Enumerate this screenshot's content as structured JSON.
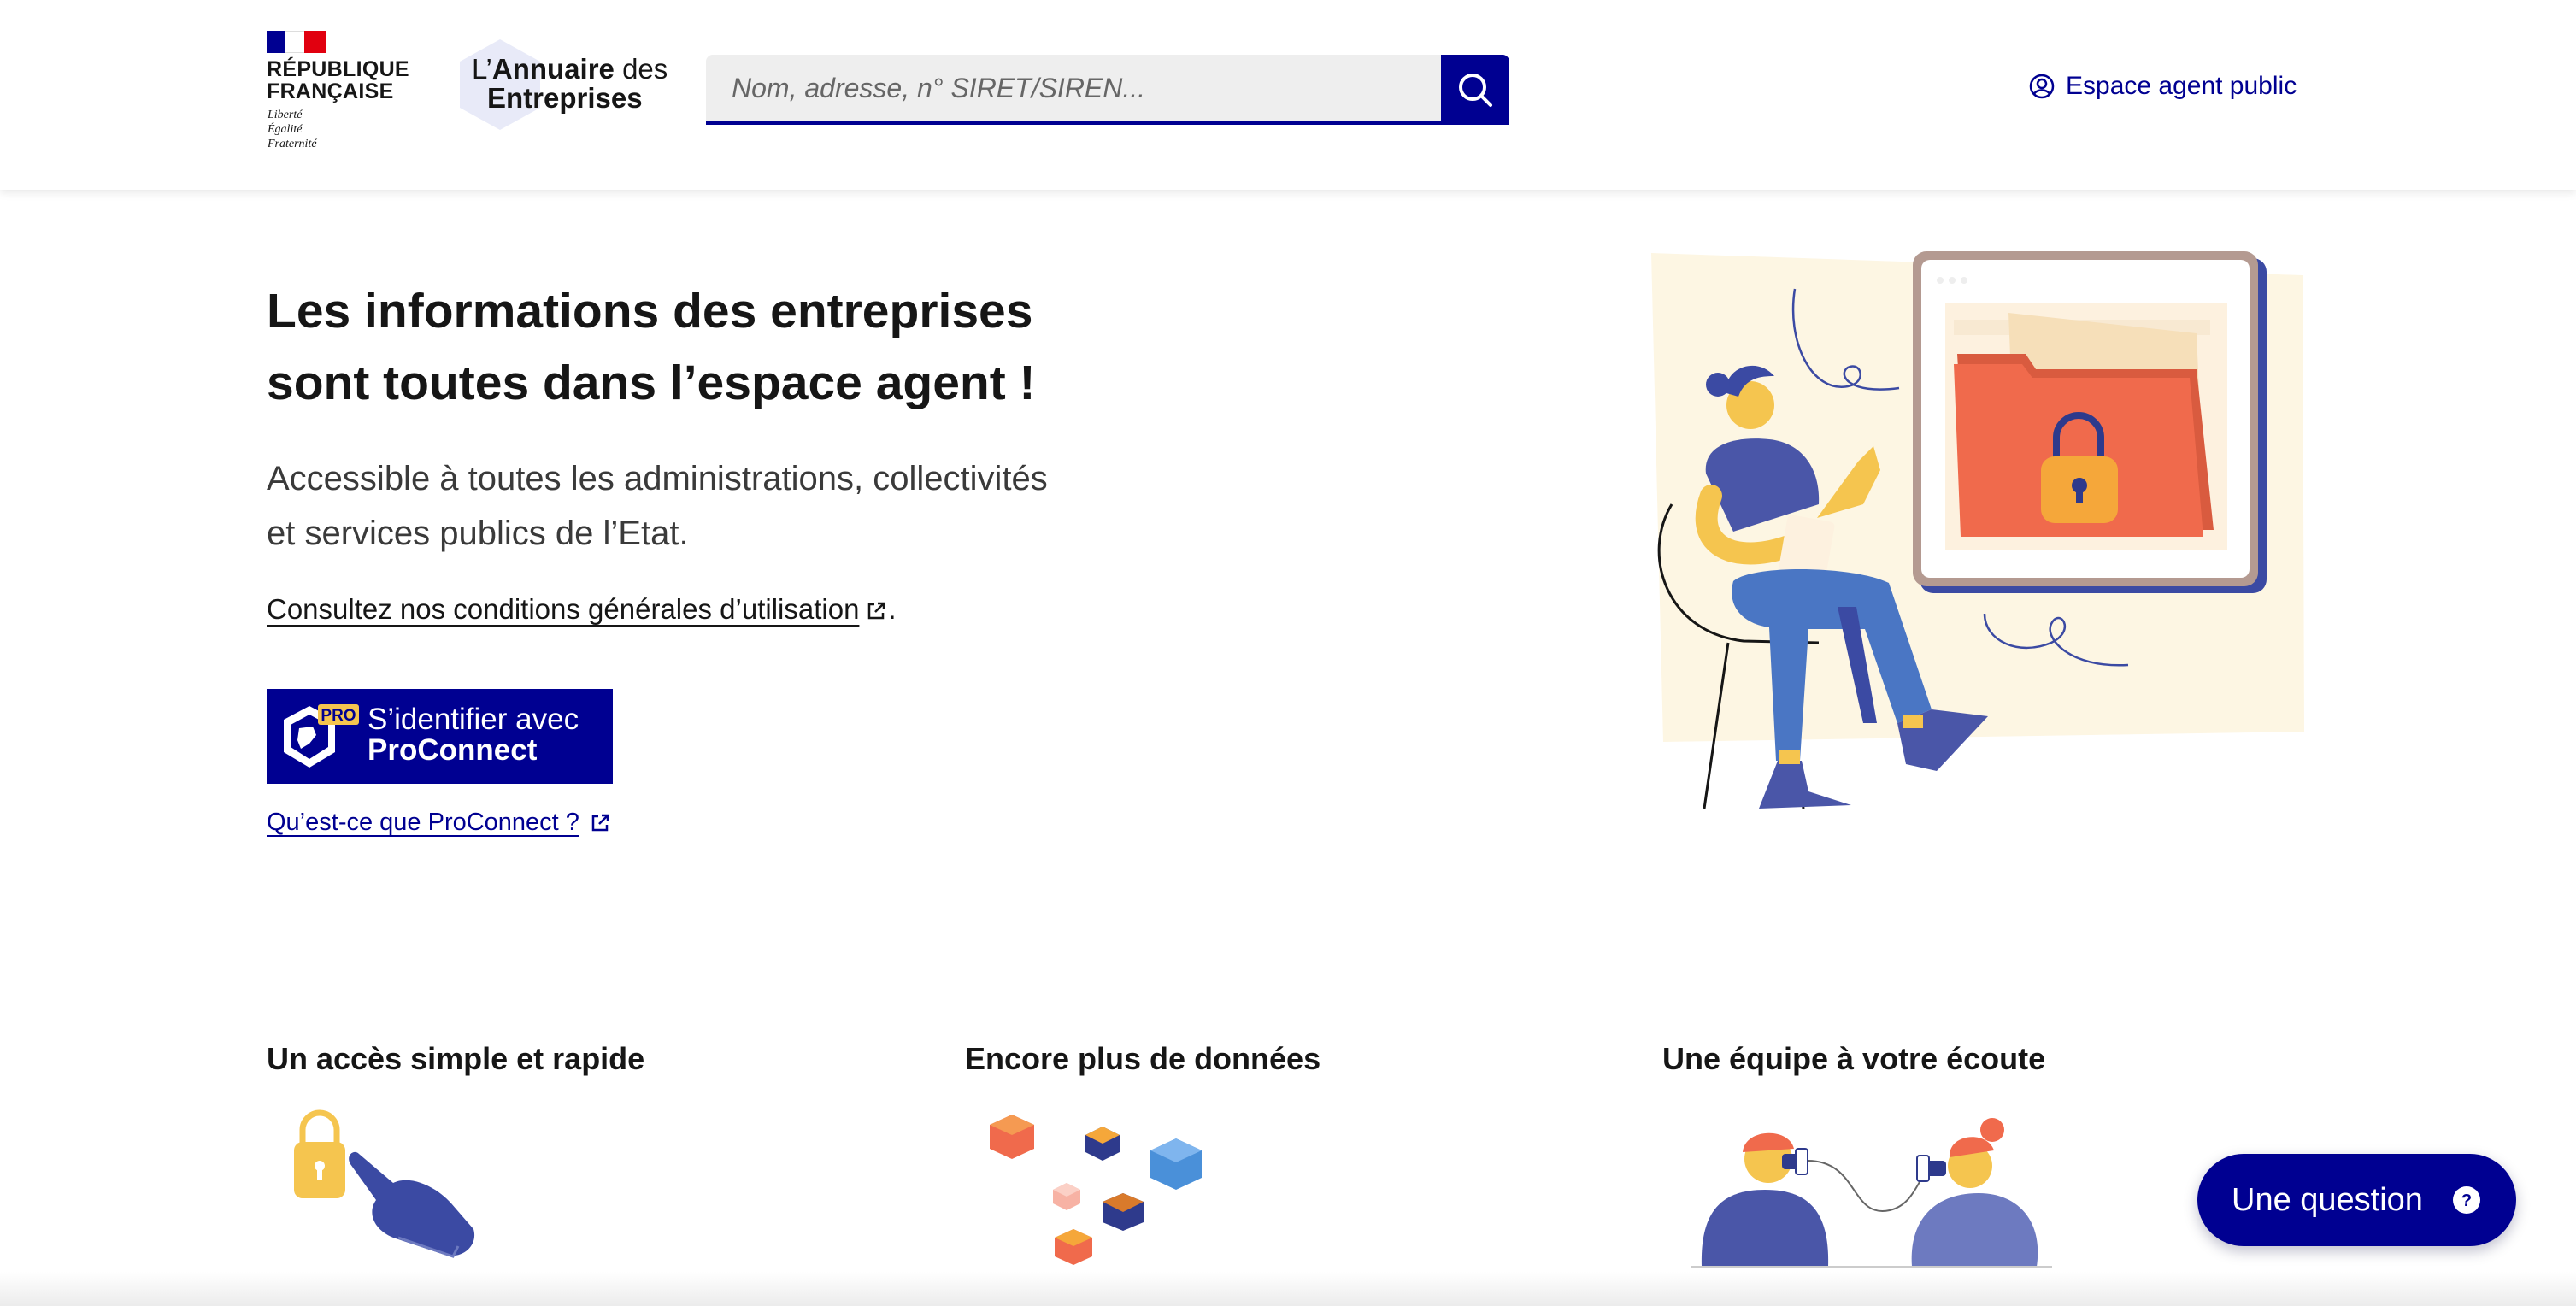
{
  "header": {
    "republic_line1": "RÉPUBLIQUE",
    "republic_line2": "FRANÇAISE",
    "motto": [
      "Liberté",
      "Égalité",
      "Fraternité"
    ],
    "logo_prefix": "L’",
    "logo_bold": "Annuaire",
    "logo_suffix": " des",
    "logo_line2": "Entreprises",
    "search_placeholder": "Nom, adresse, n° SIRET/SIREN...",
    "agent_link": "Espace agent public"
  },
  "hero": {
    "title_line1": "Les informations des entreprises",
    "title_line2": "sont toutes dans l’espace agent !",
    "subtitle_line1": "Accessible à toutes les administrations, collectivités",
    "subtitle_line2": "et services publics de l’Etat.",
    "cgu_link": "Consultez nos conditions générales d’utilisation",
    "cgu_suffix": ".",
    "proconnect_badge": "PRO",
    "proconnect_line1": "S’identifier avec",
    "proconnect_line2": "ProConnect",
    "what_proconnect": "Qu’est-ce que ProConnect ?"
  },
  "features": [
    {
      "title": "Un accès simple et rapide"
    },
    {
      "title": "Encore plus de données"
    },
    {
      "title": "Une équipe à votre écoute"
    }
  ],
  "question_button": "Une question",
  "colors": {
    "primary_blue": "#000091",
    "marianne_red": "#e1000f",
    "illustration_orange": "#f06a4c",
    "illustration_yellow": "#f5c54f",
    "illustration_cream": "#fdf6e3"
  }
}
